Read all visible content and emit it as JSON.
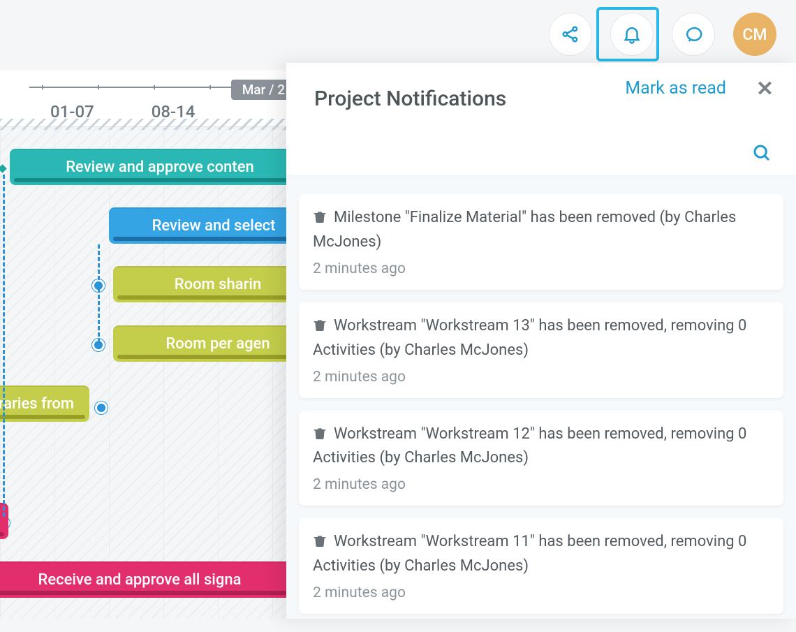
{
  "topbar": {
    "avatar_initials": "CM"
  },
  "gantt": {
    "month_pill": "Mar / 2",
    "date_cols": [
      "01-07",
      "08-14"
    ],
    "bars": {
      "b1": "Review and approve conten",
      "b2": "Review and select",
      "b3": "Room sharin",
      "b4": "Room per agen",
      "b5": "raries from",
      "b6": "",
      "b7": "Receive and approve all signa"
    }
  },
  "notifications": {
    "title": "Project Notifications",
    "mark_read": "Mark as read",
    "items": [
      {
        "msg": "Milestone \"Finalize Material\" has been removed (by Charles McJones)",
        "time": "2 minutes ago"
      },
      {
        "msg": "Workstream \"Workstream 13\" has been removed, removing 0 Activities (by Charles McJones)",
        "time": "2 minutes ago"
      },
      {
        "msg": "Workstream \"Workstream 12\" has been removed, removing 0 Activities (by Charles McJones)",
        "time": "2 minutes ago"
      },
      {
        "msg": "Workstream \"Workstream 11\" has been removed, removing 0 Activities (by Charles McJones)",
        "time": "2 minutes ago"
      }
    ]
  }
}
